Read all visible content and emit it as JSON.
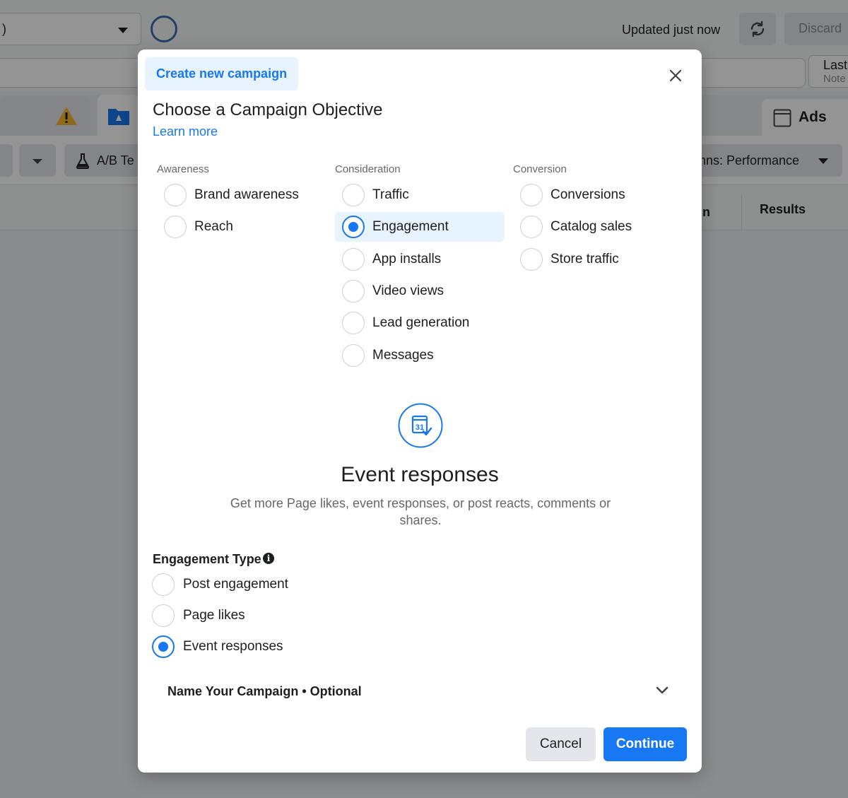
{
  "background": {
    "account_dropdown": ")",
    "updated_text": "Updated just now",
    "discard_label": "Discard",
    "last_label": "Last",
    "last_sub": "Note",
    "ads_tab": "Ads",
    "ab_test_label": "A/B Te",
    "columns_label": "mns: Performance",
    "header_col_fragment": "n",
    "header_results": "Results"
  },
  "modal": {
    "badge": "Create new campaign",
    "title": "Choose a Campaign Objective",
    "learn_more": "Learn more",
    "columns": [
      {
        "label": "Awareness",
        "options": [
          "Brand awareness",
          "Reach"
        ]
      },
      {
        "label": "Consideration",
        "options": [
          "Traffic",
          "Engagement",
          "App installs",
          "Video views",
          "Lead generation",
          "Messages"
        ]
      },
      {
        "label": "Conversion",
        "options": [
          "Conversions",
          "Catalog sales",
          "Store traffic"
        ]
      }
    ],
    "selected_objective": "Engagement",
    "hero": {
      "icon": "calendar-31-icon",
      "icon_text": "31",
      "title": "Event responses",
      "description": "Get more Page likes, event responses, or post reacts, comments or shares."
    },
    "engagement_type": {
      "label": "Engagement Type",
      "info_icon": "i",
      "options": [
        "Post engagement",
        "Page likes",
        "Event responses"
      ],
      "selected": "Event responses"
    },
    "name_campaign": "Name Your Campaign • Optional",
    "cancel_label": "Cancel",
    "continue_label": "Continue"
  },
  "colors": {
    "accent": "#1877f2",
    "accent_light": "#e7f3ff",
    "overlay": "rgba(0,0,0,0.42)"
  }
}
